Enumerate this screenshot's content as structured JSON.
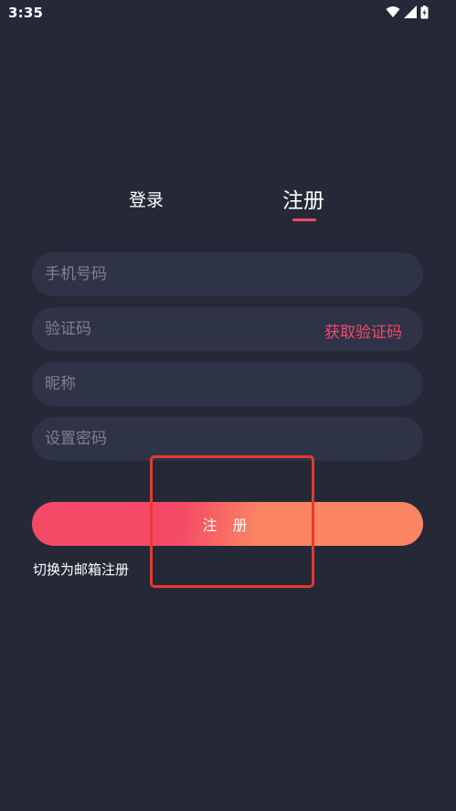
{
  "status_bar": {
    "time": "3:35",
    "icons": [
      "wifi-icon",
      "signal-icon",
      "battery-icon"
    ]
  },
  "tabs": {
    "login_label": "登录",
    "register_label": "注册",
    "active": "register"
  },
  "form": {
    "phone_placeholder": "手机号码",
    "code_placeholder": "验证码",
    "get_code_label": "获取验证码",
    "nickname_placeholder": "昵称",
    "password_placeholder": "设置密码",
    "submit_label": "注 册",
    "switch_label": "切换为邮箱注册"
  },
  "colors": {
    "background": "#252836",
    "field_background": "#2f3347",
    "accent": "#f34a67",
    "gradient_end": "#fb8562",
    "highlight_box": "#e53a2f"
  }
}
